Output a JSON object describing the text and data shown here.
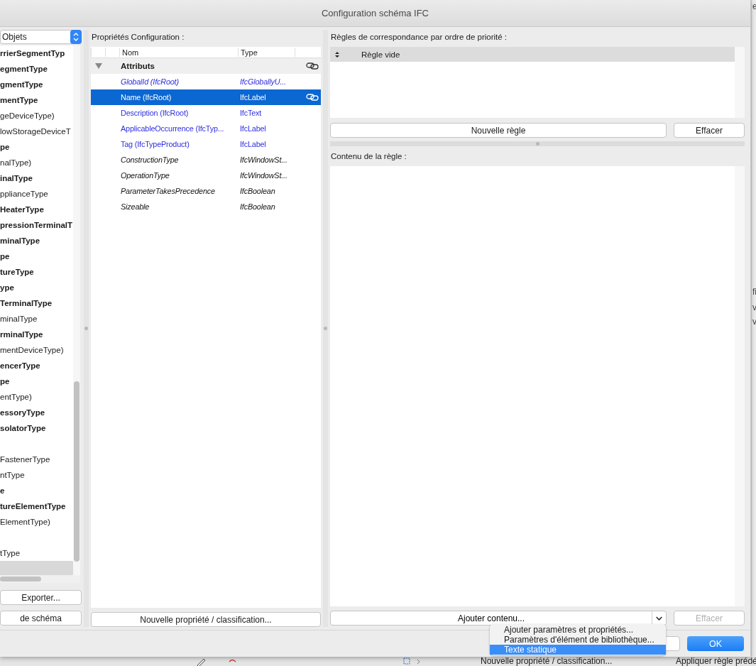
{
  "window": {
    "title": "Configuration schéma IFC"
  },
  "left_panel": {
    "dropdown": "Objets",
    "items": [
      {
        "label": "rrierSegmentTyp",
        "bold": true,
        "selected": false
      },
      {
        "label": "egmentType",
        "bold": true,
        "selected": false
      },
      {
        "label": "gmentType",
        "bold": true,
        "selected": false
      },
      {
        "label": "mentType",
        "bold": true,
        "selected": false
      },
      {
        "label": "geDeviceType)",
        "bold": false,
        "selected": false
      },
      {
        "label": "lowStorageDeviceT",
        "bold": false,
        "selected": false
      },
      {
        "label": "pe",
        "bold": true,
        "selected": false
      },
      {
        "label": "nalType)",
        "bold": false,
        "selected": false
      },
      {
        "label": "inalType",
        "bold": true,
        "selected": false
      },
      {
        "label": "pplianceType",
        "bold": false,
        "selected": false
      },
      {
        "label": "HeaterType",
        "bold": true,
        "selected": false
      },
      {
        "label": "pressionTerminalT",
        "bold": true,
        "selected": false
      },
      {
        "label": "minalType",
        "bold": true,
        "selected": false
      },
      {
        "label": "pe",
        "bold": true,
        "selected": false
      },
      {
        "label": "tureType",
        "bold": true,
        "selected": false
      },
      {
        "label": "ype",
        "bold": true,
        "selected": false
      },
      {
        "label": "TerminalType",
        "bold": true,
        "selected": false
      },
      {
        "label": "minalType",
        "bold": false,
        "selected": false
      },
      {
        "label": "rminalType",
        "bold": true,
        "selected": false
      },
      {
        "label": "mentDeviceType)",
        "bold": false,
        "selected": false
      },
      {
        "label": "encerType",
        "bold": true,
        "selected": false
      },
      {
        "label": "pe",
        "bold": true,
        "selected": false
      },
      {
        "label": "entType)",
        "bold": false,
        "selected": false
      },
      {
        "label": "essoryType",
        "bold": true,
        "selected": false
      },
      {
        "label": "solatorType",
        "bold": true,
        "selected": false
      },
      {
        "selected": false
      },
      {
        "label": "FastenerType",
        "bold": false,
        "selected": false
      },
      {
        "label": "ntType",
        "bold": false,
        "selected": false
      },
      {
        "label": "e",
        "bold": true,
        "selected": false
      },
      {
        "label": "tureElementType",
        "bold": true,
        "selected": false
      },
      {
        "label": "ElementType)",
        "bold": false,
        "selected": false
      },
      {
        "selected": false
      },
      {
        "label": "tType",
        "bold": false,
        "selected": false
      },
      {
        "selected": true
      }
    ],
    "buttons": [
      "Exporter...",
      "de schéma"
    ]
  },
  "properties": {
    "label": "Propriétés Configuration :",
    "columns": [
      "Nom",
      "Type"
    ],
    "group": {
      "label": "Attributs",
      "expanded": true,
      "linked": true
    },
    "rows": [
      {
        "name": "GlobalId (IfcRoot)",
        "type": "IfcGloballyU...",
        "kind": "standard",
        "italic": true,
        "selected": false,
        "linked": false
      },
      {
        "name": "Name (IfcRoot)",
        "type": "IfcLabel",
        "italic": false,
        "selected": true,
        "linked": true
      },
      {
        "name": "Description (IfcRoot)",
        "type": "IfcText",
        "kind": "standard",
        "italic": false,
        "selected": false,
        "linked": false
      },
      {
        "name": "ApplicableOccurrence (IfcTyp...",
        "type": "IfcLabel",
        "kind": "standard",
        "italic": false,
        "selected": false,
        "linked": false
      },
      {
        "name": "Tag (IfcTypeProduct)",
        "type": "IfcLabel",
        "kind": "standard",
        "italic": false,
        "selected": false,
        "linked": false
      },
      {
        "name": "ConstructionType",
        "type": "IfcWindowSt...",
        "kind": "extended",
        "italic": true,
        "selected": false,
        "linked": false
      },
      {
        "name": "OperationType",
        "type": "IfcWindowSt...",
        "kind": "extended",
        "italic": true,
        "selected": false,
        "linked": false
      },
      {
        "name": "ParameterTakesPrecedence",
        "type": "IfcBoolean",
        "kind": "extended",
        "italic": true,
        "selected": false,
        "linked": false
      },
      {
        "name": "Sizeable",
        "type": "IfcBoolean",
        "kind": "extended",
        "italic": true,
        "selected": false,
        "linked": false
      }
    ],
    "button": "Nouvelle propriété / classification..."
  },
  "rules": {
    "label": "Règles de correspondance par ordre de priorité :",
    "column": "Règle vide",
    "buttons": [
      {
        "label": "Nouvelle règle",
        "disabled": false
      },
      {
        "label": "Effacer",
        "disabled": false
      }
    ]
  },
  "rule_content": {
    "label": "Contenu de la règle :",
    "add_button": "Ajouter contenu...",
    "clear_button": {
      "label": "Effacer",
      "disabled": true
    },
    "menu": [
      {
        "label": "Ajouter paramètres et propriétés...",
        "selected": false
      },
      {
        "label": "Paramètres d'élément de bibliothèque...",
        "selected": false
      },
      {
        "label": "Texte statique",
        "selected": true
      }
    ]
  },
  "dialog_buttons": {
    "ok": "OK"
  },
  "background": {
    "bottom_texts": [
      "Nouvelle propriété / classification...",
      "Appliquer règle prédé"
    ],
    "edge_texts": [
      "e",
      "fi",
      "v",
      "v"
    ]
  }
}
